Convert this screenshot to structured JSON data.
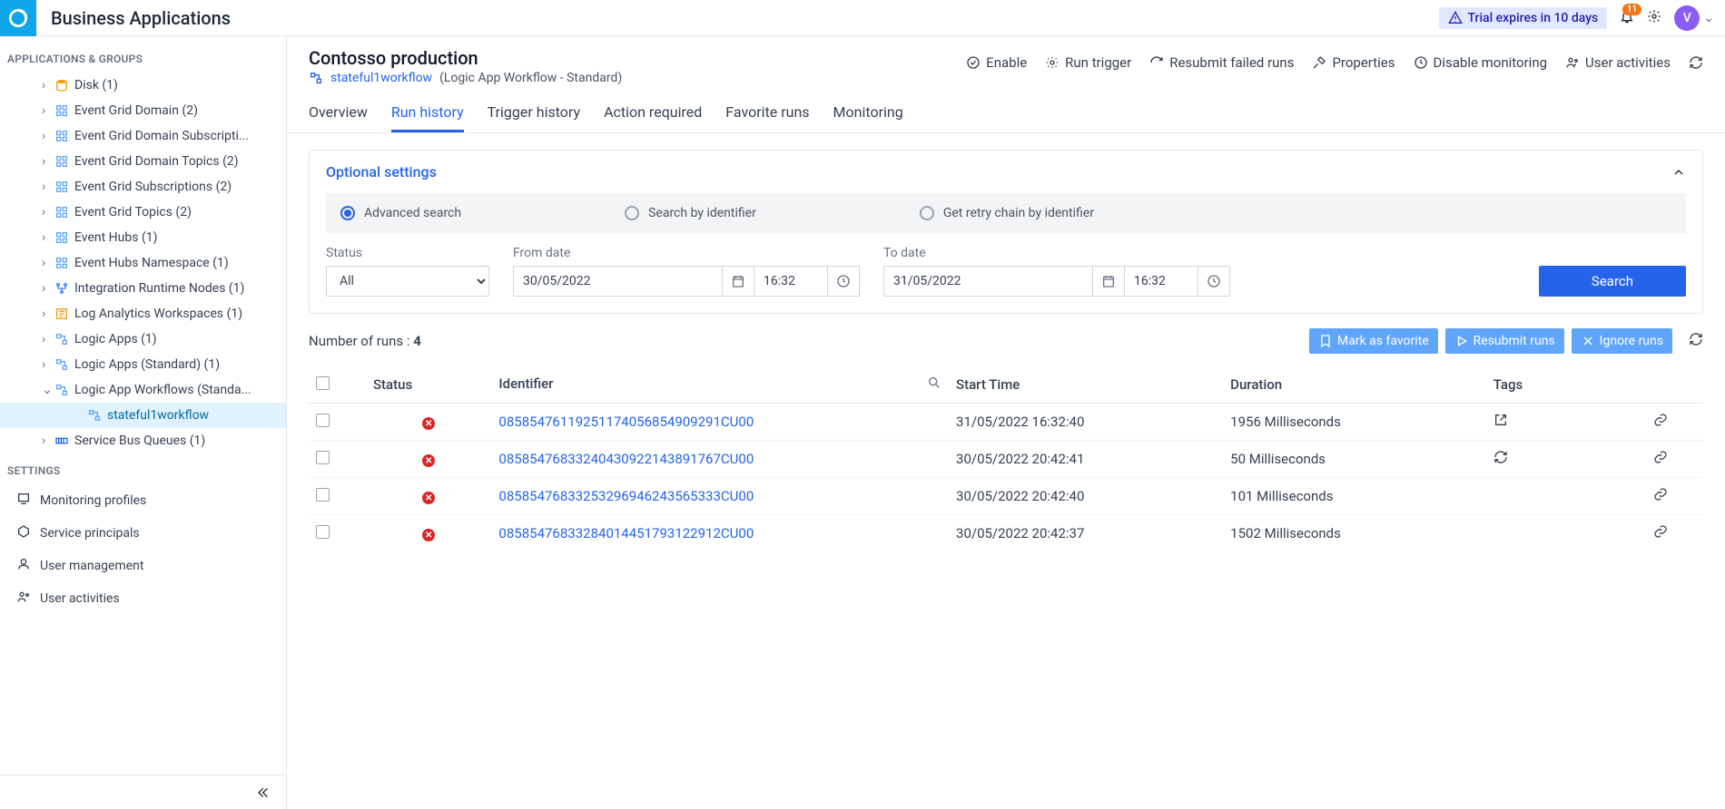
{
  "topbar": {
    "app_title": "Business Applications",
    "trial_text": "Trial expires in 10 days",
    "notif_count": "11",
    "avatar_letter": "V"
  },
  "sidebar": {
    "heading1": "APPLICATIONS & GROUPS",
    "items": [
      {
        "label": "Disk (1)",
        "icon": "disk"
      },
      {
        "label": "Event Grid Domain (2)",
        "icon": "grid"
      },
      {
        "label": "Event Grid Domain Subscripti...",
        "icon": "grid"
      },
      {
        "label": "Event Grid Domain Topics (2)",
        "icon": "grid"
      },
      {
        "label": "Event Grid Subscriptions (2)",
        "icon": "grid"
      },
      {
        "label": "Event Grid Topics (2)",
        "icon": "grid"
      },
      {
        "label": "Event Hubs (1)",
        "icon": "grid"
      },
      {
        "label": "Event Hubs Namespace (1)",
        "icon": "grid"
      },
      {
        "label": "Integration Runtime Nodes (1)",
        "icon": "nodes"
      },
      {
        "label": "Log Analytics Workspaces (1)",
        "icon": "log"
      },
      {
        "label": "Logic Apps (1)",
        "icon": "logic"
      },
      {
        "label": "Logic Apps (Standard) (1)",
        "icon": "logic"
      },
      {
        "label": "Logic App Workflows (Standa...",
        "icon": "logic",
        "expanded": true
      },
      {
        "label": "Service Bus Queues (1)",
        "icon": "queue"
      }
    ],
    "child_item": "stateful1workflow",
    "heading2": "SETTINGS",
    "settings": [
      {
        "label": "Monitoring profiles"
      },
      {
        "label": "Service principals"
      },
      {
        "label": "User management"
      },
      {
        "label": "User activities"
      }
    ]
  },
  "page": {
    "title": "Contosso production",
    "workflow_name": "stateful1workflow",
    "workflow_type": "(Logic App Workflow - Standard)",
    "actions": {
      "enable": "Enable",
      "run_trigger": "Run trigger",
      "resubmit": "Resubmit failed runs",
      "properties": "Properties",
      "disable_mon": "Disable monitoring",
      "user_act": "User activities"
    }
  },
  "tabs": [
    "Overview",
    "Run history",
    "Trigger history",
    "Action required",
    "Favorite runs",
    "Monitoring"
  ],
  "panel": {
    "title": "Optional settings",
    "radios": {
      "advanced": "Advanced search",
      "by_id": "Search by identifier",
      "retry": "Get retry chain by identifier"
    },
    "status_label": "Status",
    "status_value": "All",
    "from_label": "From date",
    "from_date": "30/05/2022",
    "from_time": "16:32",
    "to_label": "To date",
    "to_date": "31/05/2022",
    "to_time": "16:32",
    "search_btn": "Search"
  },
  "runs": {
    "count_label": "Number of runs  : ",
    "count": "4",
    "btns": {
      "fav": "Mark as favorite",
      "resub": "Resubmit runs",
      "ignore": "Ignore runs"
    },
    "headers": {
      "status": "Status",
      "identifier": "Identifier",
      "start": "Start Time",
      "duration": "Duration",
      "tags": "Tags"
    },
    "rows": [
      {
        "id": "08585476119251174056854909291CU00",
        "start": "31/05/2022 16:32:40",
        "dur": "1956 Milliseconds",
        "tag": "ext"
      },
      {
        "id": "08585476833240430922143891767CU00",
        "start": "30/05/2022 20:42:41",
        "dur": "50 Milliseconds",
        "tag": "ref"
      },
      {
        "id": "08585476833253296946243565333CU00",
        "start": "30/05/2022 20:42:40",
        "dur": "101 Milliseconds",
        "tag": ""
      },
      {
        "id": "08585476833284014451793122912CU00",
        "start": "30/05/2022 20:42:37",
        "dur": "1502 Milliseconds",
        "tag": ""
      }
    ]
  }
}
